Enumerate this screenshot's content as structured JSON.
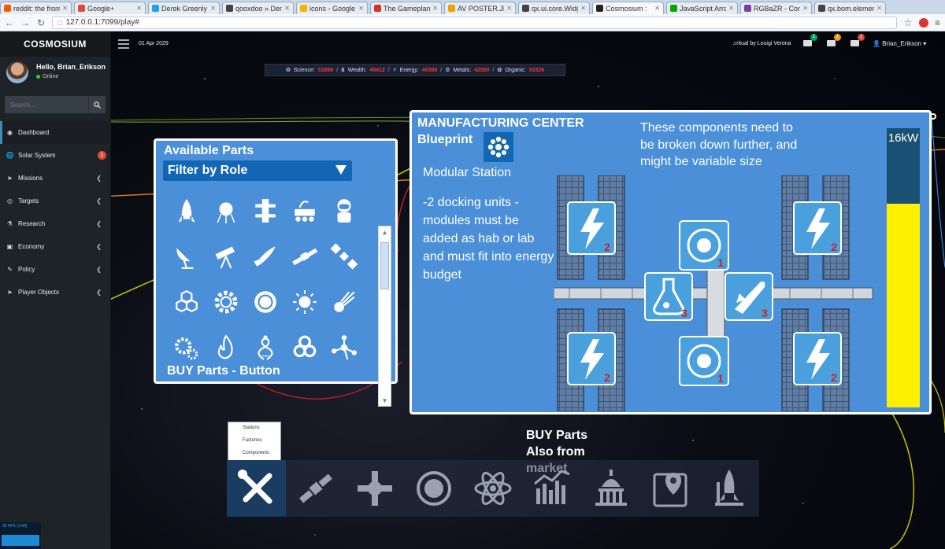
{
  "browser": {
    "tabs": [
      {
        "label": "reddit: the front",
        "color": "#ff5700"
      },
      {
        "label": "Google+",
        "color": "#dd4b39"
      },
      {
        "label": "Derek Greenly (",
        "color": "#1da1f2"
      },
      {
        "label": "qooxdoo » Demo",
        "color": "#444"
      },
      {
        "label": "icons - Google D",
        "color": "#f4b400"
      },
      {
        "label": "The Gameplan -",
        "color": "#d93025"
      },
      {
        "label": "AV POSTER.JPG",
        "color": "#e8a400"
      },
      {
        "label": "qx.ui.core.Widge",
        "color": "#444"
      },
      {
        "label": "Cosmosium :",
        "color": "#222",
        "active": true
      },
      {
        "label": "JavaScript Array",
        "color": "#0a0"
      },
      {
        "label": "RGBaZR - Conv",
        "color": "#7a3da8"
      },
      {
        "label": "qx.bom.element",
        "color": "#444"
      }
    ],
    "url": "127.0.0.1:7099/play#"
  },
  "app": {
    "brand": "COSMOSIUM",
    "user_greeting": "Hello, Brian_Erikson",
    "user_status": "Online",
    "search_placeholder": "Search...",
    "date": "01 Apr 2029",
    "music": "ritual by Louigi Verona",
    "username": "Brian_Erikson",
    "notifications": [
      {
        "icon": "envelope-icon",
        "count": "1",
        "color": "#00a65a"
      },
      {
        "icon": "envelope-icon",
        "count": "1",
        "color": "#f39c12"
      },
      {
        "icon": "envelope-icon",
        "count": "1",
        "color": "#dd4b39"
      }
    ]
  },
  "sidebar": {
    "items": [
      {
        "label": "Dashboard",
        "icon": "dashboard-icon",
        "active": true
      },
      {
        "label": "Solar System",
        "icon": "globe-icon",
        "badge": "1"
      },
      {
        "label": "Missions",
        "icon": "rocket-icon",
        "chevron": true
      },
      {
        "label": "Targets",
        "icon": "target-icon",
        "chevron": true
      },
      {
        "label": "Research",
        "icon": "flask-icon",
        "chevron": true
      },
      {
        "label": "Economy",
        "icon": "money-icon",
        "chevron": true
      },
      {
        "label": "Policy",
        "icon": "policy-icon",
        "chevron": true
      },
      {
        "label": "Player Objects",
        "icon": "rocket-icon",
        "chevron": true
      }
    ],
    "fps": "60 FPS (1-60)"
  },
  "resources": {
    "science_label": "Science:",
    "science": "51866",
    "wealth_label": "Wealth:",
    "wealth": "49412",
    "energy_label": "Energy:",
    "energy": "46580",
    "metals_label": "Metals:",
    "metals": "42500",
    "organic_label": "Organic:",
    "organic": "51526"
  },
  "parts_panel": {
    "title": "Available Parts",
    "filter": "Filter by Role",
    "buy_label": "BUY Parts - Button",
    "icons": [
      "rocket-icon",
      "sputnik-icon",
      "station-truss-icon",
      "rover-icon",
      "astronaut-icon",
      "satellite-dish-icon",
      "telescope-icon",
      "shuttle-icon",
      "satellite-icon",
      "solar-satellite-icon",
      "molecule-icon",
      "gear-icon",
      "ring-icon",
      "sun-icon",
      "comet-icon",
      "gears-icon",
      "fire-icon",
      "dna-icon",
      "biohazard-icon",
      "molecule-node-icon"
    ]
  },
  "manufacturing": {
    "title": "MANUFACTURING CENTER",
    "subtitle": "Blueprint",
    "note": "These components need to be broken down further, and might be variable size",
    "station_name": "Modular Station",
    "description": "-2 docking units -modules must be added as hab or lab and must fit into energy budget",
    "energy_label": "16kW",
    "energy_fraction": 0.73,
    "module_counts": {
      "power_tl": "2",
      "power_tr": "2",
      "power_bl": "2",
      "power_br": "2",
      "dock_top": "1",
      "dock_bottom": "1",
      "lab_left": "3",
      "hab_right": "3"
    }
  },
  "bottom": {
    "menu": [
      "Stations",
      "Factories",
      "Components"
    ],
    "buy_market": "BUY Parts Also from market",
    "toolbar": [
      "tools-icon",
      "satellite-icon",
      "station-icon",
      "asteroid-icon",
      "atom-icon",
      "market-chart-icon",
      "capitol-icon",
      "map-pin-icon",
      "launch-icon"
    ]
  }
}
